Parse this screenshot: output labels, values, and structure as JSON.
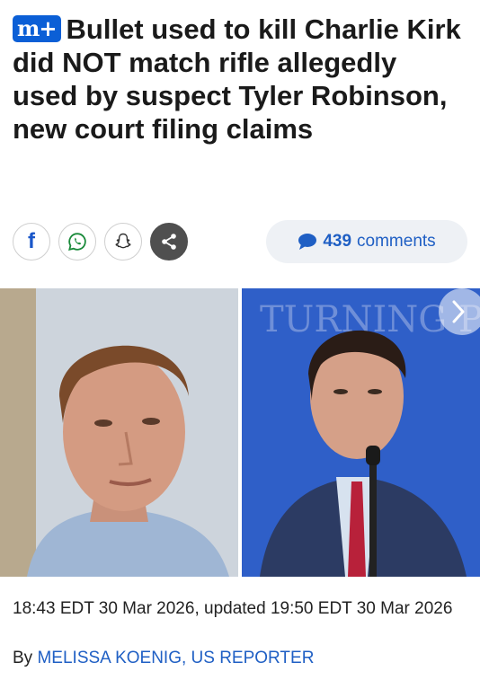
{
  "article": {
    "badge": "m+",
    "headline": "Bullet used to kill Charlie Kirk did NOT match rifle allegedly used by suspect Tyler Robinson, new court filing claims",
    "timestamp": "18:43 EDT 30 Mar 2026, updated 19:50 EDT 30 Mar 2026",
    "byline_prefix": "By",
    "author": "MELISSA KOENIG, US REPORTER"
  },
  "share": {
    "buttons": [
      {
        "name": "facebook",
        "icon": "facebook-icon"
      },
      {
        "name": "whatsapp",
        "icon": "whatsapp-icon"
      },
      {
        "name": "snapchat",
        "icon": "snapchat-icon"
      },
      {
        "name": "more",
        "icon": "share-icon"
      }
    ],
    "facebook_glyph": "f"
  },
  "comments": {
    "count": "439",
    "label": "comments"
  },
  "photos": {
    "backdrop_text": "TURNING POINT AC",
    "next_icon": "chevron-right-icon"
  },
  "colors": {
    "accent": "#1f5fc4",
    "badge_bg": "#0b5fd6",
    "stage_blue": "#2a52b6"
  }
}
